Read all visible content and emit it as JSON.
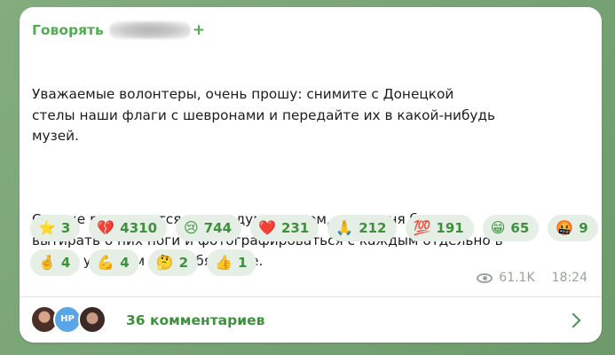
{
  "message": {
    "sender_name": "Говорять",
    "sender_suffix": "+",
    "paragraphs": [
      "Уважаемые волонтеры, очень прошу: снимите с Донецкой\nстелы наши флаги с шевронами и передайте их в какой-нибудь\nмузей.",
      "Сердце разрывается, когда думаю о том, как русня будет\nвытирать о них ноги и фотографироваться с каждым отдельно в\nлюбом удобном для себя месте."
    ],
    "reactions": [
      {
        "icon": "star-icon",
        "emoji": "⭐",
        "count": "3"
      },
      {
        "icon": "broken-heart-icon",
        "emoji": "💔",
        "count": "4310"
      },
      {
        "icon": "crying-face-icon",
        "emoji": "😢",
        "count": "744"
      },
      {
        "icon": "red-heart-icon",
        "emoji": "❤️",
        "count": "231"
      },
      {
        "icon": "folded-hands-icon",
        "emoji": "🙏",
        "count": "212"
      },
      {
        "icon": "hundred-points-icon",
        "emoji": "💯",
        "count": "191"
      },
      {
        "icon": "grinning-face-icon",
        "emoji": "😁",
        "count": "65"
      },
      {
        "icon": "cursing-face-icon",
        "emoji": "🤬",
        "count": "9"
      },
      {
        "icon": "fingers-crossed-icon",
        "emoji": "🤞",
        "count": "4"
      },
      {
        "icon": "flexed-arm-icon",
        "emoji": "💪",
        "count": "4"
      },
      {
        "icon": "thinking-face-icon",
        "emoji": "🤔",
        "count": "2"
      },
      {
        "icon": "thumbs-up-icon",
        "emoji": "👍",
        "count": "1"
      }
    ],
    "views": "61.1K",
    "time": "18:24"
  },
  "comments": {
    "avatar_initials": "HP",
    "label": "36 комментариев"
  },
  "colors": {
    "accent": "#4fae4e",
    "reaction_bg": "#e5efe5",
    "background": "#7fa87b"
  }
}
